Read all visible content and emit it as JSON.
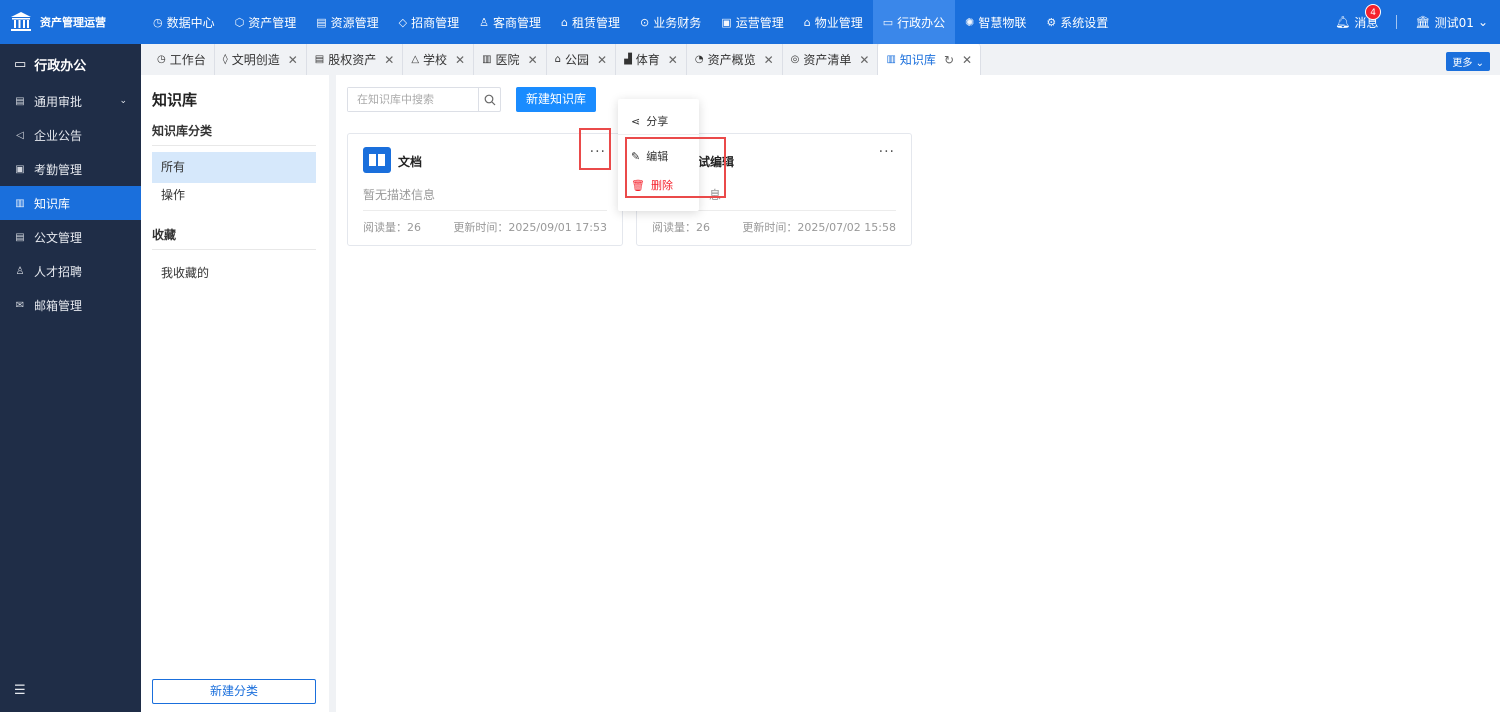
{
  "brand": {
    "name": "资产管理运营"
  },
  "topnav": [
    {
      "label": "数据中心",
      "icon": "clock-icon",
      "glyph": "◷"
    },
    {
      "label": "资产管理",
      "icon": "cube-icon",
      "glyph": "⬡"
    },
    {
      "label": "资源管理",
      "icon": "building-icon",
      "glyph": "▤"
    },
    {
      "label": "招商管理",
      "icon": "tag-icon",
      "glyph": "◇"
    },
    {
      "label": "客商管理",
      "icon": "users-icon",
      "glyph": "♙"
    },
    {
      "label": "租赁管理",
      "icon": "house-icon",
      "glyph": "⌂"
    },
    {
      "label": "业务财务",
      "icon": "coin-icon",
      "glyph": "⊙"
    },
    {
      "label": "运营管理",
      "icon": "chart-icon",
      "glyph": "▣"
    },
    {
      "label": "物业管理",
      "icon": "home-icon",
      "glyph": "⌂"
    },
    {
      "label": "行政办公",
      "icon": "monitor-icon",
      "glyph": "▭",
      "active": true
    },
    {
      "label": "智慧物联",
      "icon": "sensor-icon",
      "glyph": "✺"
    },
    {
      "label": "系统设置",
      "icon": "gear-icon",
      "glyph": "⚙"
    }
  ],
  "topright": {
    "messages_label": "消息",
    "messages_count": "4",
    "user_label": "测试01"
  },
  "sidebar": {
    "header": "行政办公",
    "items": [
      {
        "label": "通用审批",
        "glyph": "▤",
        "icon": "document-icon",
        "hasChevron": true
      },
      {
        "label": "企业公告",
        "glyph": "◁",
        "icon": "megaphone-icon"
      },
      {
        "label": "考勤管理",
        "glyph": "▣",
        "icon": "calendar-icon"
      },
      {
        "label": "知识库",
        "glyph": "▥",
        "icon": "book-icon",
        "active": true
      },
      {
        "label": "公文管理",
        "glyph": "▤",
        "icon": "file-icon"
      },
      {
        "label": "人才招聘",
        "glyph": "♙",
        "icon": "person-icon"
      },
      {
        "label": "邮箱管理",
        "glyph": "✉",
        "icon": "mail-icon"
      }
    ]
  },
  "tabs": [
    {
      "label": "工作台",
      "glyph": "◷",
      "icon": "dashboard-icon",
      "closable": false
    },
    {
      "label": "文明创造",
      "glyph": "◊",
      "icon": "location-icon",
      "closable": true
    },
    {
      "label": "股权资产",
      "glyph": "▤",
      "icon": "database-icon",
      "closable": true
    },
    {
      "label": "学校",
      "glyph": "△",
      "icon": "school-icon",
      "closable": true
    },
    {
      "label": "医院",
      "glyph": "▥",
      "icon": "hospital-icon",
      "closable": true
    },
    {
      "label": "公园",
      "glyph": "⌂",
      "icon": "park-icon",
      "closable": true
    },
    {
      "label": "体育",
      "glyph": "▟",
      "icon": "sport-icon",
      "closable": true
    },
    {
      "label": "资产概览",
      "glyph": "◔",
      "icon": "overview-icon",
      "closable": true
    },
    {
      "label": "资产清单",
      "glyph": "◎",
      "icon": "list-icon",
      "closable": true
    },
    {
      "label": "知识库",
      "glyph": "▥",
      "icon": "book-icon",
      "closable": true,
      "active": true
    }
  ],
  "tabbar": {
    "more_label": "更多"
  },
  "left_panel": {
    "title": "知识库",
    "category_title": "知识库分类",
    "cat_all": "所有",
    "cat_ops": "操作",
    "fav_title": "收藏",
    "fav_mine": "我收藏的",
    "new_category": "新建分类"
  },
  "main": {
    "search_placeholder": "在知识库中搜索",
    "new_kb_label": "新建知识库",
    "cards": [
      {
        "title": "文档",
        "desc": "暂无描述信息",
        "reads": "阅读量：26",
        "updated": "更新时间：2025/09/01 17:53"
      },
      {
        "title_visible": "试编辑",
        "desc_visible": "息",
        "reads": "阅读量：26",
        "updated": "更新时间：2025/07/02 15:58"
      }
    ],
    "more_glyph": "···"
  },
  "dropdown": {
    "share": "分享",
    "edit": "编辑",
    "delete": "删除"
  },
  "colors": {
    "primary": "#1a6fdc",
    "sidebar": "#1f2d47",
    "danger": "#f5222d",
    "highlight": "#ea4a4a"
  }
}
